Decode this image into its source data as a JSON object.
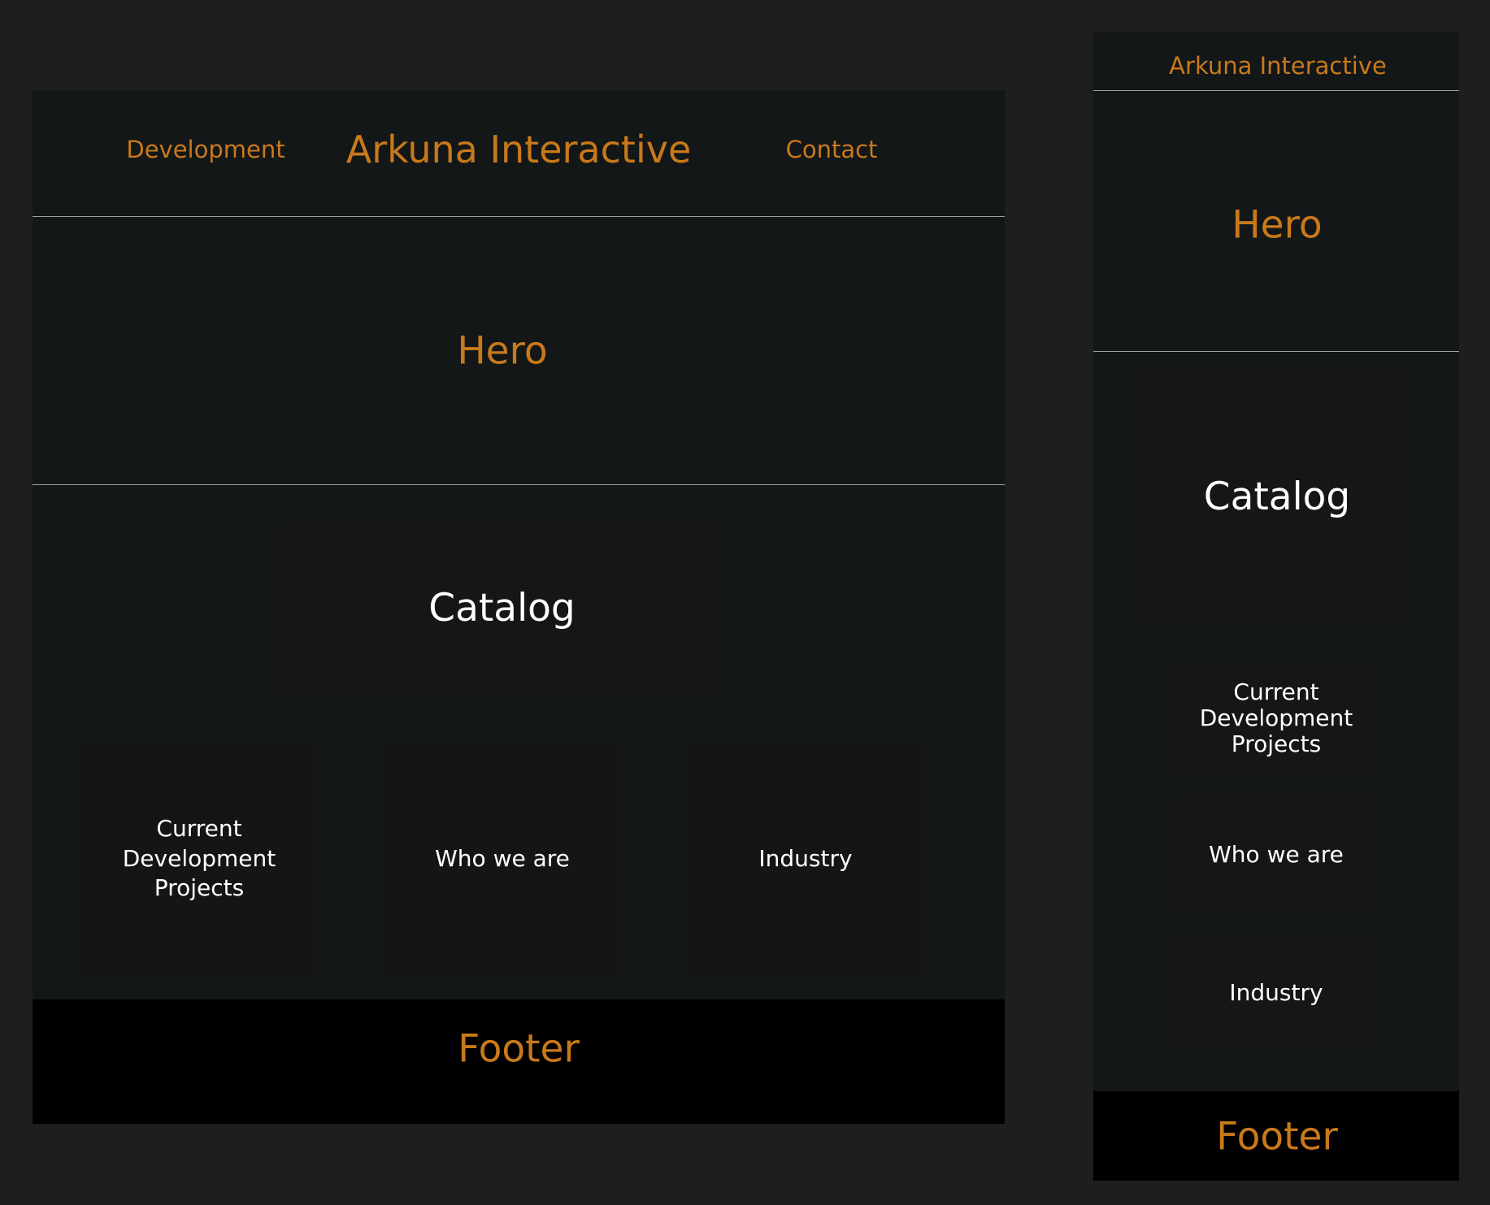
{
  "colors": {
    "canvas_bg": "#1e1e1e",
    "frame_bg": "#131718",
    "panel_bg": "#161616",
    "accent": "#c9791a",
    "text": "#ffffff",
    "footer_bg": "#000000",
    "divider": "#9ea2a4"
  },
  "desktop": {
    "header": {
      "nav_development": "Development",
      "brand": "Arkuna Interactive",
      "nav_contact": "Contact"
    },
    "hero": {
      "label": "Hero"
    },
    "catalog": {
      "label": "Catalog"
    },
    "cards": [
      {
        "label": "Current Development Projects"
      },
      {
        "label": "Who we are"
      },
      {
        "label": "Industry"
      }
    ],
    "footer": {
      "label": "Footer"
    }
  },
  "mobile": {
    "header": {
      "brand": "Arkuna Interactive"
    },
    "hero": {
      "label": "Hero"
    },
    "catalog": {
      "label": "Catalog"
    },
    "cards": [
      {
        "label": "Current Development Projects"
      },
      {
        "label": "Who we are"
      },
      {
        "label": "Industry"
      }
    ],
    "footer": {
      "label": "Footer"
    }
  }
}
